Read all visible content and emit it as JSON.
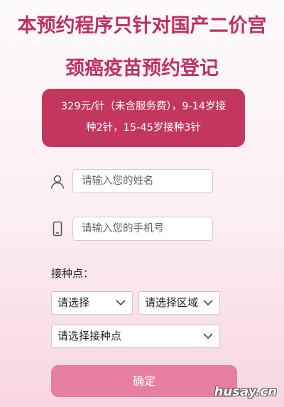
{
  "header": {
    "title_line1": "本预约程序只针对国产二价宫",
    "title_line2": "颈癌疫苗预约登记"
  },
  "notice": {
    "line1": "329元/针（未含服务费），9-14岁接",
    "line2": "种2针，15-45岁接种3针"
  },
  "form": {
    "name_placeholder": "请输入您的姓名",
    "phone_placeholder": "请输入您的手机号",
    "site_label": "接种点：",
    "select_city": "请选择",
    "select_area": "请选择区域",
    "select_site": "请选择接种点",
    "confirm_label": "确定"
  },
  "icons": {
    "name": "person-icon",
    "phone": "phone-icon",
    "dropdown": "chevron-down-icon"
  },
  "watermark": "husay.cn",
  "colors": {
    "accent": "#c0305f",
    "notice_bg": "#c3375f",
    "button_bg": "#e77fa0"
  }
}
